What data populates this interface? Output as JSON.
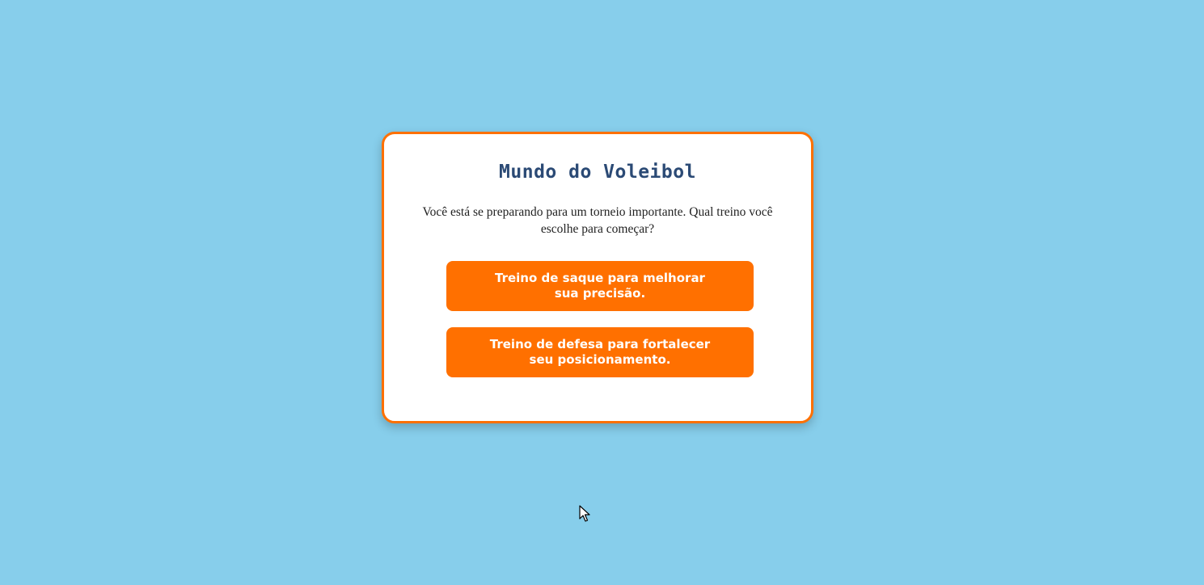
{
  "game": {
    "title": "Mundo do Voleibol",
    "question": "Você está se preparando para um torneio importante. Qual treino você escolhe para começar?",
    "choices": [
      {
        "label": "Treino de saque para melhorar sua precisão."
      },
      {
        "label": "Treino de defesa para fortalecer seu posicionamento."
      }
    ]
  },
  "colors": {
    "background": "#87CEEB",
    "accent": "#FF7000",
    "title": "#2B4A75",
    "card": "#FFFFFF"
  },
  "icons": {
    "cursor": "mouse-pointer-icon"
  }
}
